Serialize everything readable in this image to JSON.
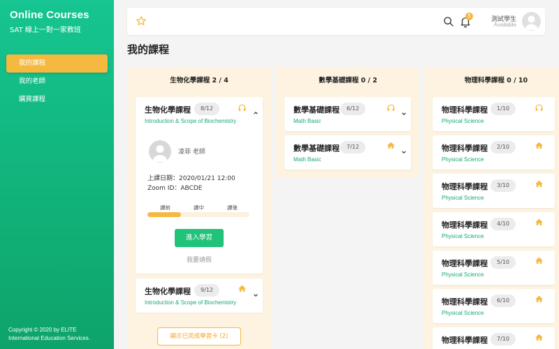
{
  "sidebar": {
    "brand": "Online Courses",
    "subtitle": "SAT 線上一對一家教班",
    "items": [
      {
        "label": "我的課程",
        "active": true
      },
      {
        "label": "我的老師",
        "active": false
      },
      {
        "label": "購買課程",
        "active": false
      }
    ],
    "copyright_line1": "Copyright © 2020 by ELITE",
    "copyright_line2": "International Education Services."
  },
  "topbar": {
    "favorite_icon": "star-icon",
    "search_icon": "search-icon",
    "notification_icon": "bell-icon",
    "notification_count": "5",
    "user_name": "測試學生",
    "user_status": "Available"
  },
  "page_title": "我的課程",
  "columns": [
    {
      "title": "生物化學課程 2 / 4",
      "cards": [
        {
          "title": "生物化學課程",
          "badge": "8/12",
          "subtitle": "Introduction & Scope of Biochemistry",
          "icon": "headphones-icon",
          "expanded": true,
          "teacher": "凌菲 老師",
          "date": "上課日期：2020/01/21 12:00",
          "zoom": "Zoom ID：ABCDE",
          "steps": [
            "課前",
            "課中",
            "課後"
          ],
          "progress": 0.33,
          "enter_label": "進入學習",
          "leave_label": "我要請假"
        },
        {
          "title": "生物化學課程",
          "badge": "9/12",
          "subtitle": "Introduction & Scope of Biochemistry",
          "icon": "home-icon",
          "expanded": false
        }
      ],
      "show_completed": "顯示已完成學習卡 (2)"
    },
    {
      "title": "數學基礎課程 0 / 2",
      "cards": [
        {
          "title": "數學基礎課程",
          "badge": "6/12",
          "subtitle": "Math Basic",
          "icon": "headphones-icon"
        },
        {
          "title": "數學基礎課程",
          "badge": "7/12",
          "subtitle": "Math Basic",
          "icon": "home-icon"
        }
      ]
    },
    {
      "title": "物理科學課程 0 / 10",
      "cards": [
        {
          "title": "物理科學課程",
          "badge": "1/10",
          "subtitle": "Physical Science",
          "icon": "headphones-icon"
        },
        {
          "title": "物理科學課程",
          "badge": "2/10",
          "subtitle": "Physical Science",
          "icon": "home-icon"
        },
        {
          "title": "物理科學課程",
          "badge": "3/10",
          "subtitle": "Physical Science",
          "icon": "home-icon"
        },
        {
          "title": "物理科學課程",
          "badge": "4/10",
          "subtitle": "Physical Science",
          "icon": "home-icon"
        },
        {
          "title": "物理科學課程",
          "badge": "5/10",
          "subtitle": "Physical Science",
          "icon": "home-icon"
        },
        {
          "title": "物理科學課程",
          "badge": "6/10",
          "subtitle": "Physical Science",
          "icon": "home-icon"
        },
        {
          "title": "物理科學課程",
          "badge": "7/10",
          "subtitle": "Physical Science",
          "icon": "home-icon"
        }
      ]
    }
  ],
  "colors": {
    "accent_green": "#16c591",
    "accent_orange": "#f5b940",
    "column_bg": "#fdf3e0",
    "button_green": "#21c27a"
  }
}
